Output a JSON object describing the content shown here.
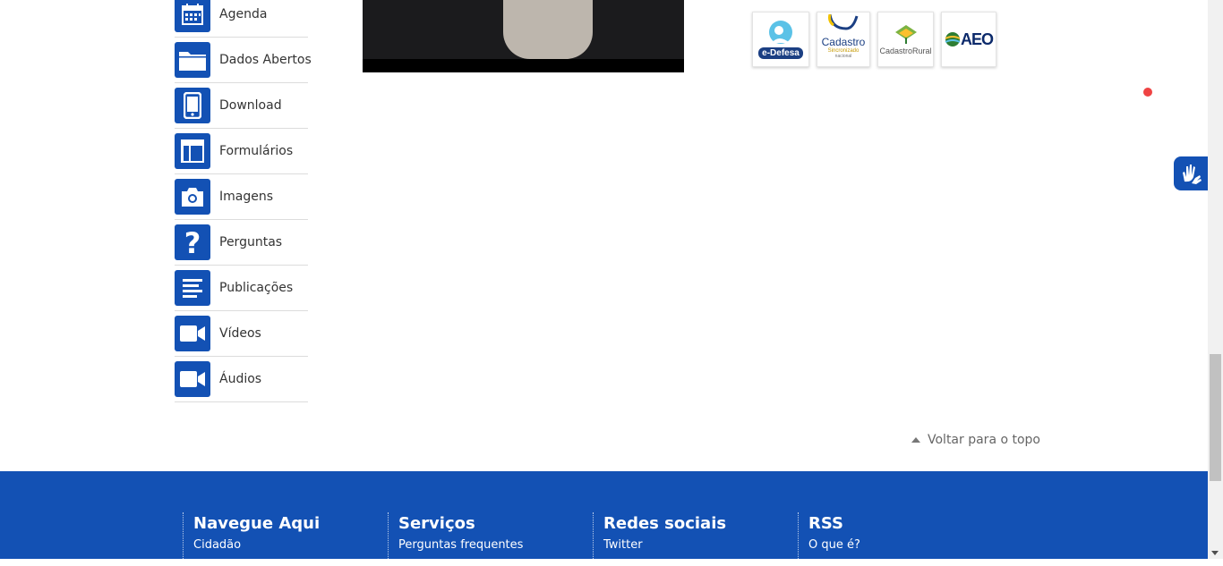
{
  "sidebar": {
    "items": [
      {
        "label": "Agenda",
        "icon": "calendar-icon"
      },
      {
        "label": "Dados Abertos",
        "icon": "folder-icon"
      },
      {
        "label": "Download",
        "icon": "mobile-icon"
      },
      {
        "label": "Formulários",
        "icon": "layout-icon"
      },
      {
        "label": "Imagens",
        "icon": "camera-icon"
      },
      {
        "label": "Perguntas",
        "icon": "question-icon"
      },
      {
        "label": "Publicações",
        "icon": "document-icon"
      },
      {
        "label": "Vídeos",
        "icon": "video-camera-icon"
      },
      {
        "label": "Áudios",
        "icon": "video-camera-icon"
      }
    ]
  },
  "logos": {
    "edefesa": "e-Defesa",
    "cadastro": "Cadastro",
    "cadastro_sub": "Sincronizado",
    "cadastro_sub2": "nacional",
    "rural": "CadastroRural",
    "aeo": "AEO"
  },
  "back_to_top": "Voltar para o topo",
  "footer": {
    "columns": [
      {
        "title": "Navegue Aqui",
        "link": "Cidadão"
      },
      {
        "title": "Serviços",
        "link": "Perguntas frequentes"
      },
      {
        "title": "Redes sociais",
        "link": "Twitter"
      },
      {
        "title": "RSS",
        "link": "O que é?"
      }
    ]
  },
  "colors": {
    "brand_blue": "#1351b4",
    "accent_red": "#ef4343"
  }
}
